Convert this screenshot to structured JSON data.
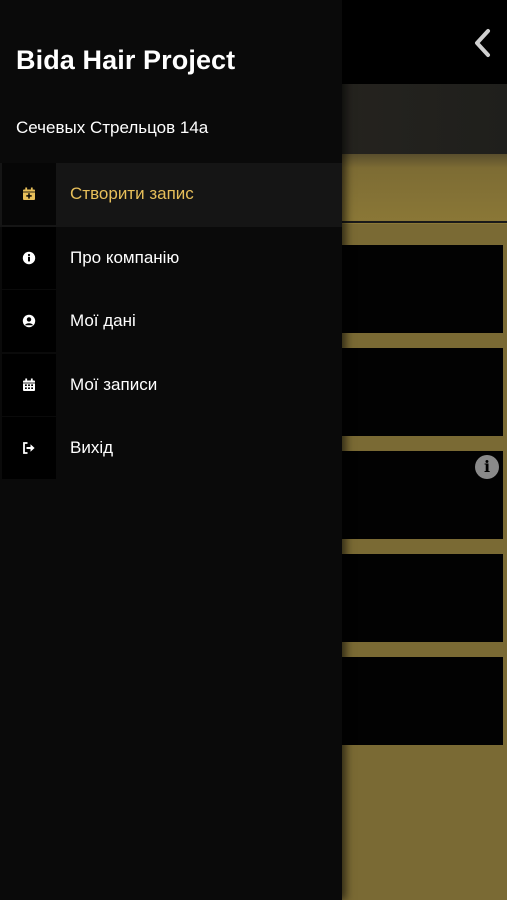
{
  "colors": {
    "accent": "#e7bf5a",
    "drawer_bg": "#0a0a0a",
    "background_gold": "#7a6a34"
  },
  "drawer": {
    "title": "Bida Hair Project",
    "address": "Сечевых Стрельцов 14а",
    "items": [
      {
        "label": "Створити запис",
        "icon": "calendar-plus-icon",
        "active": true
      },
      {
        "label": "Про компанію",
        "icon": "info-circle-icon",
        "active": false
      },
      {
        "label": "Мої дані",
        "icon": "user-circle-icon",
        "active": false
      },
      {
        "label": "Мої записи",
        "icon": "calendar-icon",
        "active": false
      },
      {
        "label": "Вихід",
        "icon": "sign-out-icon",
        "active": false
      }
    ]
  },
  "background": {
    "back_icon": "chevron-left-icon",
    "info_icon": "info-circle-icon"
  }
}
